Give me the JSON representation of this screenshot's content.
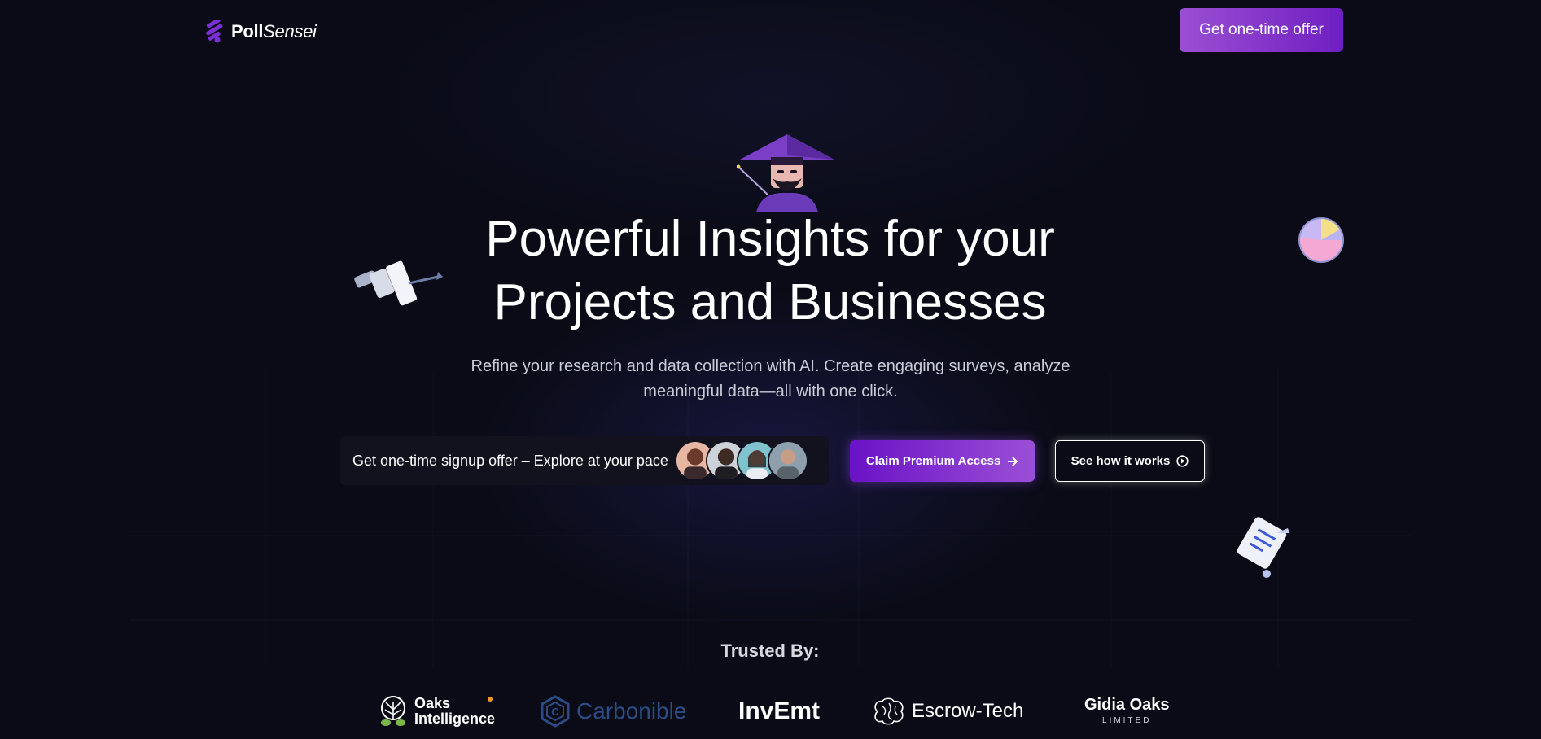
{
  "header": {
    "logo": {
      "bold": "Poll",
      "light": "Sensei"
    },
    "cta_label": "Get one-time offer"
  },
  "hero": {
    "title_line1": "Powerful Insights for your",
    "title_line2": "Projects and Businesses",
    "subtitle_line1": "Refine your research and data collection with AI. Create engaging surveys, analyze",
    "subtitle_line2": "meaningful data—all with one click."
  },
  "offer": {
    "text": "Get one-time signup offer – Explore at your pace",
    "avatars": [
      "avatar-1",
      "avatar-2",
      "avatar-3",
      "avatar-4"
    ]
  },
  "buttons": {
    "claim_label": "Claim Premium Access",
    "how_label": "See how it works"
  },
  "trusted": {
    "heading": "Trusted By:",
    "brands": {
      "oaks_line1": "Oaks",
      "oaks_line2": "Intelligence",
      "carbonible": "Carbonible",
      "invemt": "InvEmt",
      "escrow": "Escrow-Tech",
      "gidia_line1": "Gidia Oaks",
      "gidia_line2": "LIMITED"
    }
  },
  "colors": {
    "background": "#0a0b16",
    "accent_purple": "#7b2cd0",
    "cta_gradient_start": "#9a4fd3",
    "cta_gradient_end": "#6f1fc1",
    "carbonible_blue": "#2a4d86"
  },
  "icons": [
    "logo-mark-icon",
    "arrow-right-icon",
    "play-circle-icon",
    "sensei-mascot",
    "pie-chart-icon",
    "bar-chart-icon",
    "survey-clipboard-icon"
  ]
}
